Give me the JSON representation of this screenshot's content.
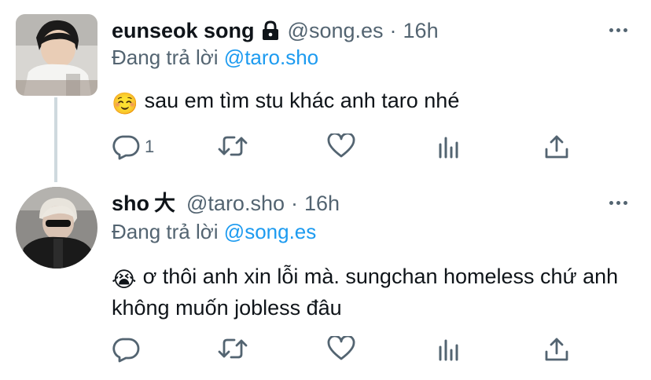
{
  "tweets": [
    {
      "display_name": "eunseok song",
      "handle": "@song.es",
      "separator": "·",
      "time": "16h",
      "protected": true,
      "replying_prefix": "Đang trả lời",
      "replying_to": "@taro.sho",
      "emoji": "☺️",
      "text": "sau em tìm stu khác anh taro nhé",
      "reply_count": "1",
      "retweet_count": "",
      "like_count": ""
    },
    {
      "display_name": "sho",
      "name_suffix": "大",
      "handle": "@taro.sho",
      "separator": "·",
      "time": "16h",
      "protected": false,
      "replying_prefix": "Đang trả lời",
      "replying_to": "@song.es",
      "emoji": "😭",
      "text": "ơ thôi anh xin lỗi mà. sungchan homeless chứ anh không muốn jobless đâu",
      "reply_count": "",
      "retweet_count": "",
      "like_count": ""
    }
  ],
  "icons": [
    "lock-icon",
    "more-icon",
    "reply-icon",
    "retweet-icon",
    "like-icon",
    "analytics-icon",
    "share-icon"
  ],
  "colors": {
    "text": "#0f1419",
    "secondary": "#536471",
    "link": "#1d9bf0",
    "thread_line": "#cfd9de"
  }
}
